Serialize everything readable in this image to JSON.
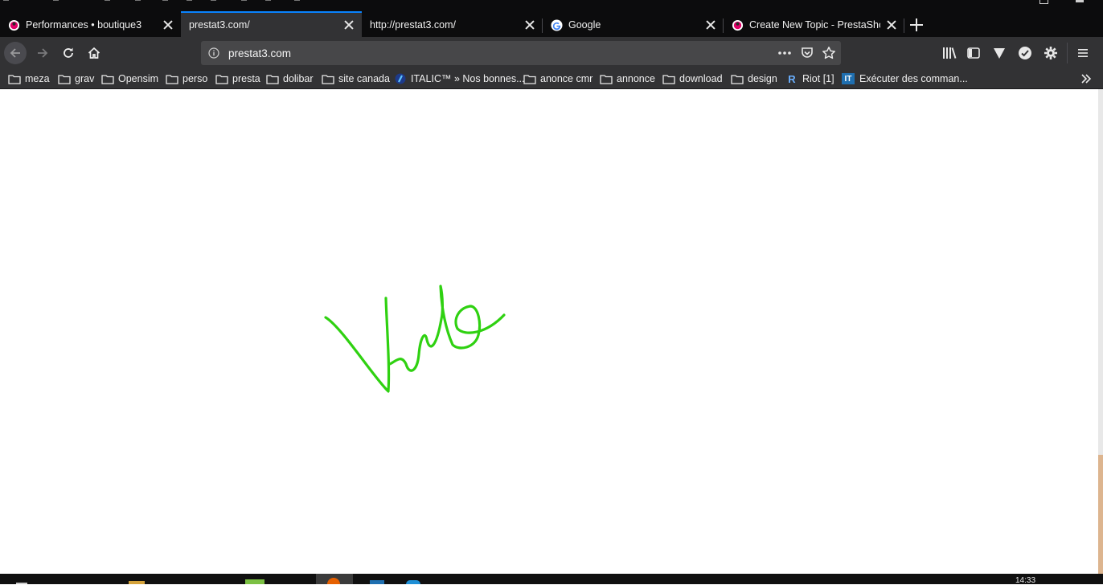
{
  "browser": {
    "tabs": [
      {
        "title": "Performances • boutique3",
        "favicon": "prestashop-icon",
        "active": false
      },
      {
        "title": "prestat3.com/",
        "favicon": "",
        "active": true
      },
      {
        "title": "http://prestat3.com/",
        "favicon": "",
        "active": false
      },
      {
        "title": "Google",
        "favicon": "google-icon",
        "active": false
      },
      {
        "title": "Create New Topic - PrestaShop",
        "favicon": "prestashop-icon",
        "active": false
      }
    ],
    "url": "prestat3.com",
    "bookmarks": [
      {
        "label": "meza",
        "icon": "folder-icon"
      },
      {
        "label": "grav",
        "icon": "folder-icon"
      },
      {
        "label": "Opensim",
        "icon": "folder-icon"
      },
      {
        "label": "perso",
        "icon": "folder-icon"
      },
      {
        "label": "presta",
        "icon": "folder-icon"
      },
      {
        "label": "dolibar",
        "icon": "folder-icon"
      },
      {
        "label": "site canada",
        "icon": "folder-icon"
      },
      {
        "label": "ITALIC™ » Nos bonnes...",
        "icon": "italic-site-icon"
      },
      {
        "label": "anonce cmr",
        "icon": "folder-icon"
      },
      {
        "label": "annonce",
        "icon": "folder-icon"
      },
      {
        "label": "download",
        "icon": "folder-icon"
      },
      {
        "label": "design",
        "icon": "folder-icon"
      },
      {
        "label": "Riot [1]",
        "icon": "riot-icon"
      },
      {
        "label": "Exécuter des comman...",
        "icon": "it-icon"
      }
    ],
    "riot_icon_letter": "R",
    "it_icon_letters": "IT"
  },
  "content": {
    "signature_color": "#2fd111"
  },
  "taskbar": {
    "clock": "14:33"
  },
  "colors": {
    "accent": "#0a84ff",
    "toolbar": "#323234",
    "tabstrip": "#0c0c0d"
  }
}
